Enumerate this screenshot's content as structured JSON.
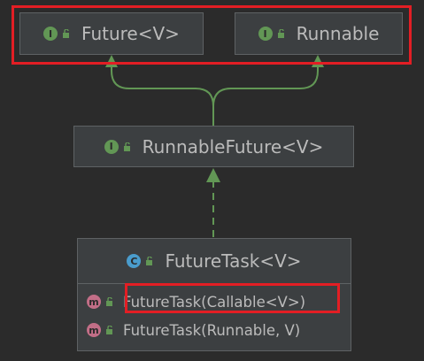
{
  "diagram": {
    "interfaces": [
      {
        "badge": "I",
        "name": "Future<V>"
      },
      {
        "badge": "I",
        "name": "Runnable"
      },
      {
        "badge": "I",
        "name": "RunnableFuture<V>"
      }
    ],
    "class": {
      "badge": "C",
      "name": "FutureTask<V>",
      "members": [
        {
          "badge": "m",
          "signature": "FutureTask(Callable<V>)"
        },
        {
          "badge": "m",
          "signature": "FutureTask(Runnable, V)"
        }
      ]
    }
  },
  "colors": {
    "background": "#2b2b2b",
    "node": "#3c3f41",
    "edge": "#629755",
    "highlight": "#e31e24"
  }
}
